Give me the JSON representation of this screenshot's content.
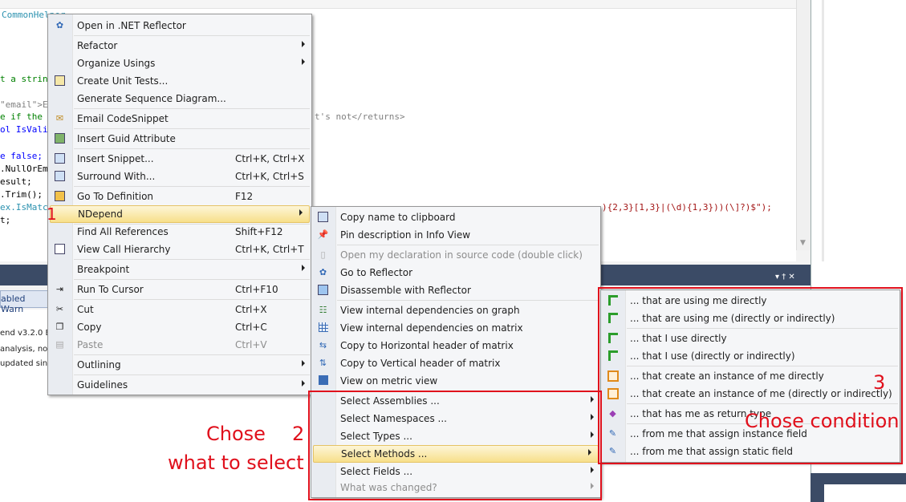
{
  "editor": {
    "tab_label": "CommonHelper",
    "code_lines": [
      "t a strin",
      "\"email\">E",
      "e if the",
      "ol IsVali",
      "e false;",
      ".NullOrEm",
      "esult;",
      ".Trim();",
      "ex.IsMatc",
      "t;"
    ],
    "code_fragment_1": "t's not</returns>",
    "code_fragment_2": "){2,3}[1,3}|(\\d){1,3}))(\\]?)$\");"
  },
  "bottom_panel": {
    "tab_label": "abled Warn",
    "lines": [
      "end v3.2.0 E",
      "analysis, no c",
      "updated sin"
    ],
    "pin_glyphs": "▾ † ✕"
  },
  "context_menu": {
    "items": [
      {
        "label": "Open in .NET Reflector",
        "icon": "reflector-icon"
      },
      {
        "label": "Refactor",
        "submenu": true
      },
      {
        "label": "Organize Usings",
        "submenu": true
      },
      {
        "label": "Create Unit Tests...",
        "icon": "unit-test-icon"
      },
      {
        "label": "Generate Sequence Diagram..."
      },
      {
        "label": "Email CodeSnippet",
        "icon": "email-icon"
      },
      {
        "label": "Insert Guid Attribute",
        "icon": "guid-icon"
      },
      {
        "label": "Insert Snippet...",
        "shortcut": "Ctrl+K, Ctrl+X",
        "icon": "snippet-icon"
      },
      {
        "label": "Surround With...",
        "shortcut": "Ctrl+K, Ctrl+S",
        "icon": "surround-icon"
      },
      {
        "label": "Go To Definition",
        "shortcut": "F12",
        "icon": "definition-icon"
      },
      {
        "label": "NDepend",
        "submenu": true
      },
      {
        "label": "Find All References",
        "shortcut": "Shift+F12"
      },
      {
        "label": "View Call Hierarchy",
        "shortcut": "Ctrl+K, Ctrl+T",
        "icon": "hierarchy-icon"
      },
      {
        "label": "Breakpoint",
        "submenu": true
      },
      {
        "label": "Run To Cursor",
        "shortcut": "Ctrl+F10",
        "icon": "run-cursor-icon"
      },
      {
        "label": "Cut",
        "shortcut": "Ctrl+X",
        "icon": "cut-icon"
      },
      {
        "label": "Copy",
        "shortcut": "Ctrl+C",
        "icon": "copy-icon"
      },
      {
        "label": "Paste",
        "shortcut": "Ctrl+V",
        "disabled": true,
        "icon": "paste-icon"
      },
      {
        "label": "Outlining",
        "submenu": true
      },
      {
        "label": "Guidelines",
        "submenu": true
      }
    ]
  },
  "ndepend_menu": {
    "items": [
      {
        "label": "Copy name to clipboard",
        "icon": "clipboard-icon"
      },
      {
        "label": "Pin description in Info View",
        "icon": "pin-icon"
      },
      {
        "label": "Open my declaration in source code (double click)",
        "disabled": true,
        "icon": "document-icon"
      },
      {
        "label": "Go to Reflector",
        "icon": "reflector-icon"
      },
      {
        "label": "Disassemble with Reflector",
        "icon": "disassemble-icon"
      },
      {
        "label": "View internal dependencies on graph",
        "icon": "graph-icon"
      },
      {
        "label": "View internal dependencies on matrix",
        "icon": "matrix-icon"
      },
      {
        "label": "Copy to Horizontal header of matrix",
        "icon": "horizontal-header-icon"
      },
      {
        "label": "Copy to Vertical header of matrix",
        "icon": "vertical-header-icon"
      },
      {
        "label": "View on metric view",
        "icon": "metric-view-icon"
      },
      {
        "label": "Select Assemblies ...",
        "submenu": true
      },
      {
        "label": "Select Namespaces ...",
        "submenu": true
      },
      {
        "label": "Select Types ...",
        "submenu": true
      },
      {
        "label": "Select Methods ...",
        "submenu": true
      },
      {
        "label": "Select Fields ...",
        "submenu": true
      },
      {
        "label": "What was changed?",
        "submenu": true,
        "disabled": true
      }
    ]
  },
  "methods_menu": {
    "items": [
      {
        "label": "... that are using me directly",
        "icon": "dependency-icon"
      },
      {
        "label": "... that are using me (directly or indirectly)",
        "icon": "dependency-indirect-icon"
      },
      {
        "label": "... that I use directly",
        "icon": "dependency-icon"
      },
      {
        "label": "... that I use (directly or indirectly)",
        "icon": "dependency-indirect-icon"
      },
      {
        "label": "... that create an instance of me directly",
        "icon": "instance-icon"
      },
      {
        "label": "... that create an instance of me (directly or indirectly)",
        "icon": "instance-indirect-icon"
      },
      {
        "label": "... that has me as return type",
        "icon": "return-type-icon"
      },
      {
        "label": "... from me that assign instance field",
        "icon": "assign-field-icon"
      },
      {
        "label": "... from me that assign static field",
        "icon": "assign-static-icon"
      }
    ]
  },
  "annotations": {
    "step1": "1",
    "step2": "2",
    "step3": "3",
    "chose_label": "Chose",
    "what_to_select": "what to select",
    "chose_condition": "Chose condition",
    "color": "#e0101c"
  }
}
